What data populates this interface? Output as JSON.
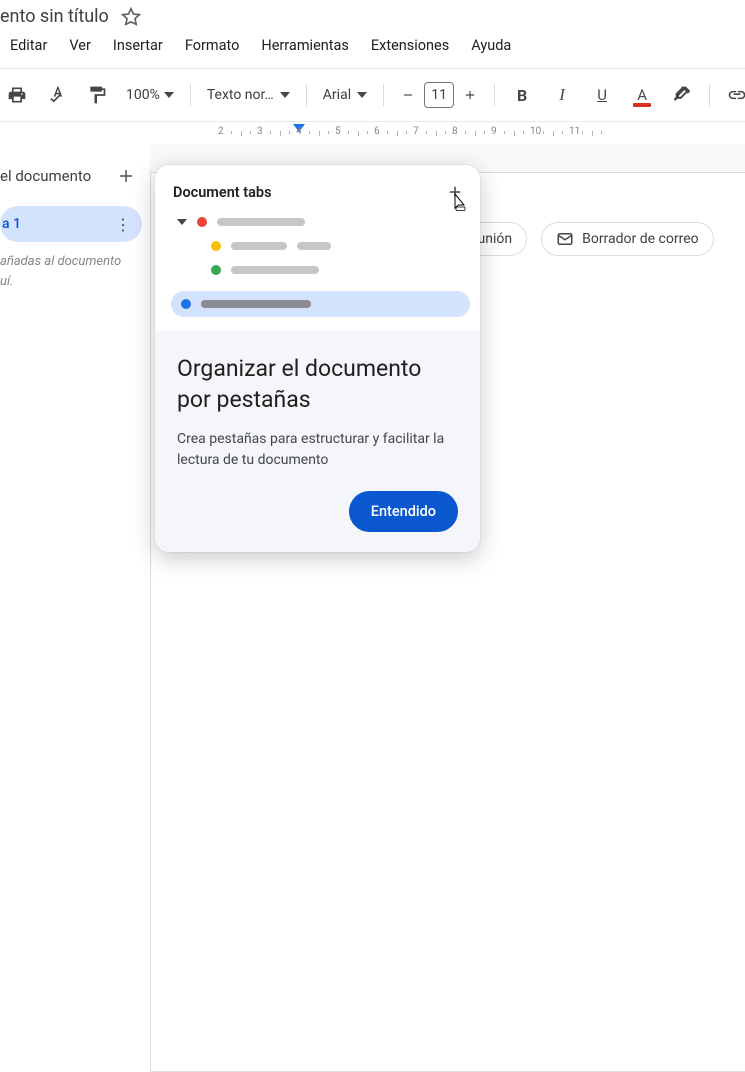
{
  "title": "ento sin título",
  "menus": [
    "Editar",
    "Ver",
    "Insertar",
    "Formato",
    "Herramientas",
    "Extensiones",
    "Ayuda"
  ],
  "toolbar": {
    "zoom": "100%",
    "style": "Texto nor…",
    "font": "Arial",
    "size": "11",
    "textcolor": "#d93025"
  },
  "ruler": {
    "start": 2,
    "end": 11
  },
  "sidebar": {
    "outline_title": "el documento",
    "active_tab": "a 1",
    "hint_line1": " añadas al documento",
    "hint_line2": "uí."
  },
  "chips": [
    {
      "icon": "group",
      "label": " la reunión"
    },
    {
      "icon": "mail",
      "label": "Borrador de correo"
    }
  ],
  "popover": {
    "head": "Document tabs",
    "rows": [
      {
        "color": "#ea4335",
        "w1": 88,
        "indent": 0,
        "caret": true
      },
      {
        "color": "#fbbc04",
        "w1": 56,
        "w2": 34,
        "indent": 1
      },
      {
        "color": "#34a853",
        "w1": 88,
        "indent": 1
      },
      {
        "color": "#1a73e8",
        "w1": 110,
        "indent": 0,
        "selected": true
      }
    ],
    "title": "Organizar el documento por pestañas",
    "desc": "Crea pestañas para estructurar y facilitar la lectura de tu documento",
    "cta": "Entendido"
  }
}
